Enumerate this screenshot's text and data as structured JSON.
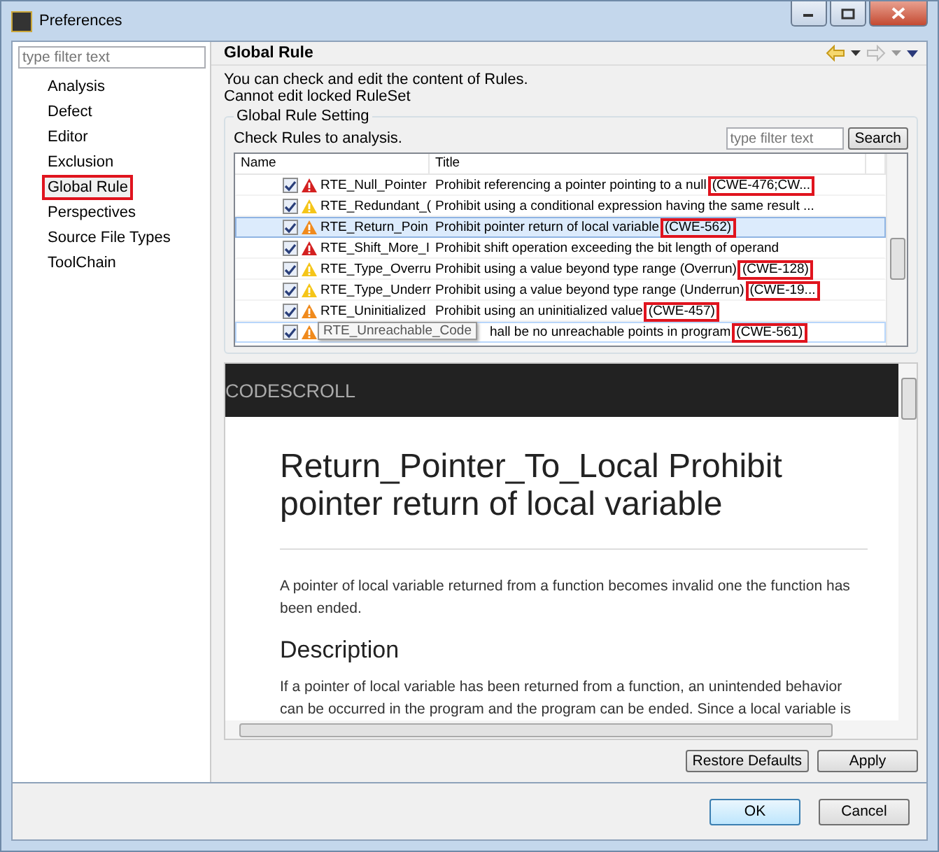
{
  "window": {
    "title": "Preferences"
  },
  "sidebar": {
    "filter": {
      "placeholder": "type filter text"
    },
    "items": [
      {
        "label": "Analysis",
        "selected": false
      },
      {
        "label": "Defect",
        "selected": false
      },
      {
        "label": "Editor",
        "selected": false
      },
      {
        "label": "Exclusion",
        "selected": false
      },
      {
        "label": "Global Rule",
        "selected": true
      },
      {
        "label": "Perspectives",
        "selected": false
      },
      {
        "label": "Source File Types",
        "selected": false
      },
      {
        "label": "ToolChain",
        "selected": false
      }
    ]
  },
  "page": {
    "title": "Global Rule",
    "description": [
      "You can check and edit the content of Rules.",
      "Cannot edit locked RuleSet"
    ],
    "group": {
      "title": "Global Rule Setting",
      "hint": "Check Rules to analysis.",
      "filter": {
        "placeholder": "type filter text"
      },
      "search_button": "Search",
      "table": {
        "columns": [
          "Name",
          "Title"
        ],
        "rows": [
          {
            "name": "RTE_Null_Pointer",
            "title": "Prohibit referencing a pointer pointing to a null",
            "cwe": "(CWE-476;CW...",
            "checked": true,
            "color": "#d42020",
            "selected": false,
            "hovered": false
          },
          {
            "name": "RTE_Redundant_(",
            "title": "Prohibit using a conditional expression having the same result ...",
            "checked": true,
            "color": "#f5c518",
            "selected": false,
            "hovered": false
          },
          {
            "name": "RTE_Return_Poin",
            "title": "Prohibit pointer return of local variable",
            "cwe": "(CWE-562)",
            "checked": true,
            "color": "#f08a1c",
            "selected": true,
            "hovered": false
          },
          {
            "name": "RTE_Shift_More_I",
            "title": "Prohibit shift operation exceeding the bit length of operand",
            "checked": true,
            "color": "#d42020",
            "selected": false,
            "hovered": false
          },
          {
            "name": "RTE_Type_Overru",
            "title": "Prohibit using a value beyond type range (Overrun)",
            "cwe": "(CWE-128)",
            "checked": true,
            "color": "#f5c518",
            "selected": false,
            "hovered": false
          },
          {
            "name": "RTE_Type_Underr",
            "title": "Prohibit using a value beyond type range (Underrun)",
            "cwe": "(CWE-19...",
            "checked": true,
            "color": "#f5c518",
            "selected": false,
            "hovered": false
          },
          {
            "name": "RTE_Uninitialized",
            "title": "Prohibit using an uninitialized value",
            "cwe": "(CWE-457)",
            "checked": true,
            "color": "#f08a1c",
            "selected": false,
            "hovered": false
          },
          {
            "tooltip": "RTE_Unreachable_Code",
            "title": "hall be no unreachable points in program",
            "cwe": "(CWE-561)",
            "checked": true,
            "color": "#f08a1c",
            "selected": false,
            "hovered": true
          }
        ]
      }
    },
    "doc": {
      "brand": "CODESCROLL",
      "heading": "Return_Pointer_To_Local Prohibit pointer return of local variable",
      "intro": "A pointer of local variable returned from a function becomes invalid one the function has been ended.",
      "section": "Description",
      "body": "If a pointer of local variable has been returned from a function, an unintended behavior can be occurred in the program and the program can be ended. Since a local variable is"
    },
    "page_buttons": [
      "Restore Defaults",
      "Apply"
    ]
  },
  "buttons": [
    "OK",
    "Cancel"
  ]
}
